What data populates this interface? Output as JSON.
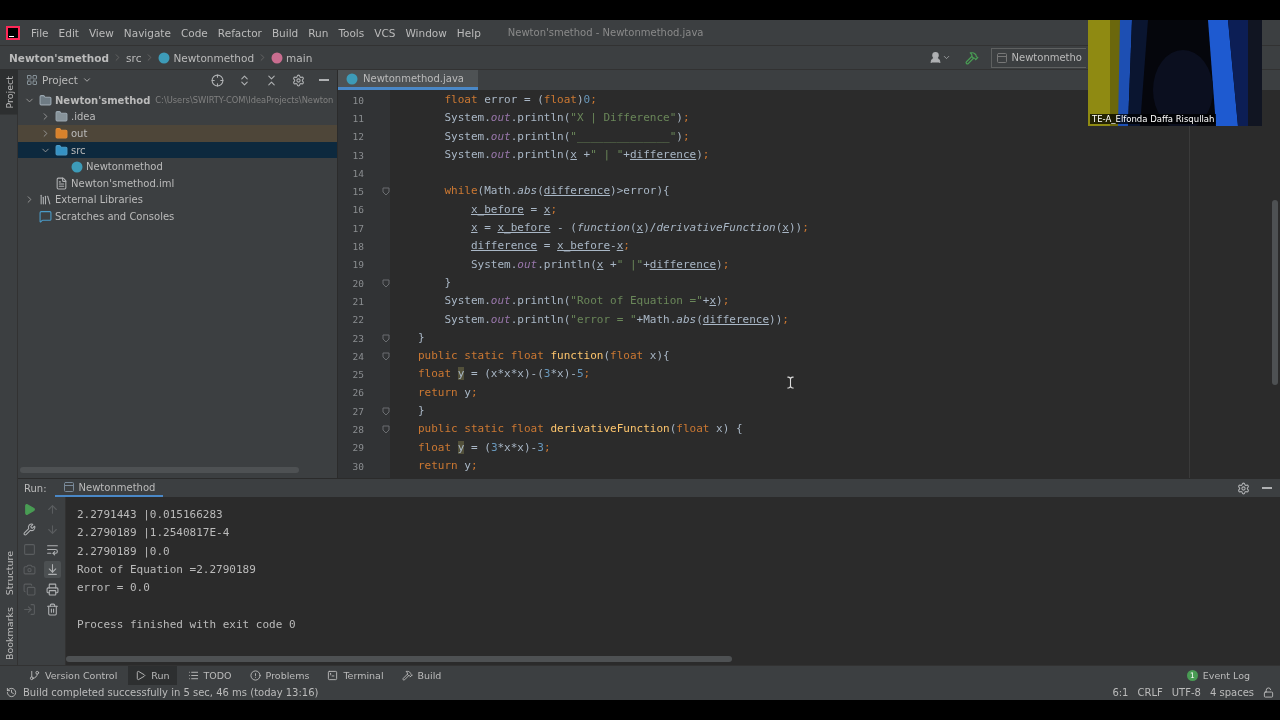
{
  "menu_bar": {
    "items": [
      "File",
      "Edit",
      "View",
      "Navigate",
      "Code",
      "Refactor",
      "Build",
      "Run",
      "Tools",
      "VCS",
      "Window",
      "Help"
    ],
    "title": "Newton'smethod - Newtonmethod.java"
  },
  "breadcrumbs": [
    {
      "label": "Newton'smethod",
      "kind": "project"
    },
    {
      "label": "src",
      "kind": "folder"
    },
    {
      "label": "Newtonmethod",
      "kind": "class"
    },
    {
      "label": "main",
      "kind": "method"
    }
  ],
  "run_config": "Newtonmetho",
  "side_tabs": [
    {
      "label": "Project",
      "selected": true
    },
    {
      "label": "Structure",
      "selected": false
    },
    {
      "label": "Bookmarks",
      "selected": false
    }
  ],
  "project_panel": {
    "title": "Project",
    "tree": [
      {
        "label": "Newton'smethod",
        "hint": "C:\\Users\\SWIRTY-COM\\IdeaProjects\\Newton",
        "kind": "module",
        "expanded": true,
        "selected": false,
        "children": [
          {
            "label": ".idea",
            "kind": "folder",
            "expanded": false,
            "selected": false
          },
          {
            "label": "out",
            "kind": "excluded",
            "expanded": false,
            "selected": false
          },
          {
            "label": "src",
            "kind": "source",
            "expanded": true,
            "selected": true,
            "children": [
              {
                "label": "Newtonmethod",
                "kind": "class",
                "selected": false
              }
            ]
          },
          {
            "label": "Newton'smethod.iml",
            "kind": "file",
            "selected": false
          }
        ]
      },
      {
        "label": "External Libraries",
        "kind": "libraries",
        "expanded": false,
        "selected": false
      },
      {
        "label": "Scratches and Consoles",
        "kind": "scratches",
        "selected": false
      }
    ]
  },
  "editor": {
    "tabs": [
      {
        "label": "Newtonmethod.java",
        "selected": true
      }
    ],
    "lines": [
      {
        "number": "10",
        "fold": false,
        "kind": "body",
        "tokens": [
          {
            "kind": "k",
            "text": "float"
          },
          {
            "kind": "t",
            "text": " error = ("
          },
          {
            "kind": "k",
            "text": "float"
          },
          {
            "kind": "t",
            "text": ")"
          },
          {
            "kind": "n",
            "text": "0"
          },
          {
            "kind": "k",
            "text": ";"
          }
        ]
      },
      {
        "number": "11",
        "fold": false,
        "kind": "body",
        "tokens": [
          {
            "kind": "t",
            "text": "System."
          },
          {
            "kind": "f",
            "text": "out"
          },
          {
            "kind": "t",
            "text": ".println("
          },
          {
            "kind": "s",
            "text": "\"X | Difference\""
          },
          {
            "kind": "t",
            "text": ")"
          },
          {
            "kind": "k",
            "text": ";"
          }
        ]
      },
      {
        "number": "12",
        "fold": false,
        "kind": "body",
        "tokens": [
          {
            "kind": "t",
            "text": "System."
          },
          {
            "kind": "f",
            "text": "out"
          },
          {
            "kind": "t",
            "text": ".println("
          },
          {
            "kind": "s",
            "text": "\"______________\""
          },
          {
            "kind": "t",
            "text": ")"
          },
          {
            "kind": "k",
            "text": ";"
          }
        ]
      },
      {
        "number": "13",
        "fold": false,
        "kind": "body",
        "tokens": [
          {
            "kind": "t",
            "text": "System."
          },
          {
            "kind": "f",
            "text": "out"
          },
          {
            "kind": "t",
            "text": ".println("
          },
          {
            "kind": "u",
            "text": "x"
          },
          {
            "kind": "t",
            "text": " +"
          },
          {
            "kind": "s",
            "text": "\" | \""
          },
          {
            "kind": "t",
            "text": "+"
          },
          {
            "kind": "u",
            "text": "difference"
          },
          {
            "kind": "t",
            "text": ")"
          },
          {
            "kind": "k",
            "text": ";"
          }
        ]
      },
      {
        "number": "14",
        "fold": false,
        "kind": "body"
      },
      {
        "number": "15",
        "fold": true,
        "kind": "body",
        "tokens": [
          {
            "kind": "k",
            "text": "while"
          },
          {
            "kind": "t",
            "text": "(Math."
          },
          {
            "kind": "i",
            "text": "abs"
          },
          {
            "kind": "t",
            "text": "("
          },
          {
            "kind": "u",
            "text": "difference"
          },
          {
            "kind": "t",
            "text": ")>error){"
          }
        ]
      },
      {
        "number": "16",
        "fold": false,
        "kind": "inner",
        "tokens": [
          {
            "kind": "u",
            "text": "x_before"
          },
          {
            "kind": "t",
            "text": " = "
          },
          {
            "kind": "u",
            "text": "x"
          },
          {
            "kind": "k",
            "text": ";"
          }
        ]
      },
      {
        "number": "17",
        "fold": false,
        "kind": "inner",
        "tokens": [
          {
            "kind": "u",
            "text": "x"
          },
          {
            "kind": "t",
            "text": " = "
          },
          {
            "kind": "u",
            "text": "x_before"
          },
          {
            "kind": "t",
            "text": " - ("
          },
          {
            "kind": "i",
            "text": "function"
          },
          {
            "kind": "t",
            "text": "("
          },
          {
            "kind": "u",
            "text": "x"
          },
          {
            "kind": "t",
            "text": ")/"
          },
          {
            "kind": "i",
            "text": "derivativeFunction"
          },
          {
            "kind": "t",
            "text": "("
          },
          {
            "kind": "u",
            "text": "x"
          },
          {
            "kind": "t",
            "text": "))"
          },
          {
            "kind": "k",
            "text": ";"
          }
        ]
      },
      {
        "number": "18",
        "fold": false,
        "kind": "inner",
        "tokens": [
          {
            "kind": "u",
            "text": "difference"
          },
          {
            "kind": "t",
            "text": " = "
          },
          {
            "kind": "u",
            "text": "x_before"
          },
          {
            "kind": "t",
            "text": "-"
          },
          {
            "kind": "u",
            "text": "x"
          },
          {
            "kind": "k",
            "text": ";"
          }
        ]
      },
      {
        "number": "19",
        "fold": false,
        "kind": "inner",
        "tokens": [
          {
            "kind": "t",
            "text": "System."
          },
          {
            "kind": "f",
            "text": "out"
          },
          {
            "kind": "t",
            "text": ".println("
          },
          {
            "kind": "u",
            "text": "x"
          },
          {
            "kind": "t",
            "text": " +"
          },
          {
            "kind": "s",
            "text": "\" |\""
          },
          {
            "kind": "t",
            "text": "+"
          },
          {
            "kind": "u",
            "text": "difference"
          },
          {
            "kind": "t",
            "text": ")"
          },
          {
            "kind": "k",
            "text": ";"
          }
        ]
      },
      {
        "number": "20",
        "fold": true,
        "kind": "body",
        "tokens": [
          {
            "kind": "t",
            "text": "}"
          }
        ]
      },
      {
        "number": "21",
        "fold": false,
        "kind": "body",
        "tokens": [
          {
            "kind": "t",
            "text": "System."
          },
          {
            "kind": "f",
            "text": "out"
          },
          {
            "kind": "t",
            "text": ".println("
          },
          {
            "kind": "s",
            "text": "\"Root of Equation =\""
          },
          {
            "kind": "t",
            "text": "+"
          },
          {
            "kind": "u",
            "text": "x"
          },
          {
            "kind": "t",
            "text": ")"
          },
          {
            "kind": "k",
            "text": ";"
          }
        ]
      },
      {
        "number": "22",
        "fold": false,
        "kind": "body",
        "tokens": [
          {
            "kind": "t",
            "text": "System."
          },
          {
            "kind": "f",
            "text": "out"
          },
          {
            "kind": "t",
            "text": ".println("
          },
          {
            "kind": "s",
            "text": "\"error = \""
          },
          {
            "kind": "t",
            "text": "+Math."
          },
          {
            "kind": "i",
            "text": "abs"
          },
          {
            "kind": "t",
            "text": "("
          },
          {
            "kind": "u",
            "text": "difference"
          },
          {
            "kind": "t",
            "text": "))"
          },
          {
            "kind": "k",
            "text": ";"
          }
        ]
      },
      {
        "number": "23",
        "fold": true,
        "kind": "top",
        "tokens": [
          {
            "kind": "t",
            "text": "}"
          }
        ]
      },
      {
        "number": "24",
        "fold": true,
        "kind": "top",
        "tokens": [
          {
            "kind": "k",
            "text": "public static float "
          },
          {
            "kind": "m",
            "text": "function"
          },
          {
            "kind": "t",
            "text": "("
          },
          {
            "kind": "k",
            "text": "float"
          },
          {
            "kind": "t",
            "text": " x){"
          }
        ]
      },
      {
        "number": "25",
        "fold": false,
        "kind": "top",
        "tokens": [
          {
            "kind": "k",
            "text": "float "
          },
          {
            "kind": "h",
            "text": "y"
          },
          {
            "kind": "t",
            "text": " = (x*x*x)-("
          },
          {
            "kind": "n",
            "text": "3"
          },
          {
            "kind": "t",
            "text": "*x)-"
          },
          {
            "kind": "n",
            "text": "5"
          },
          {
            "kind": "k",
            "text": ";"
          }
        ]
      },
      {
        "number": "26",
        "fold": false,
        "kind": "top",
        "tokens": [
          {
            "kind": "k",
            "text": "return"
          },
          {
            "kind": "t",
            "text": " y"
          },
          {
            "kind": "k",
            "text": ";"
          }
        ]
      },
      {
        "number": "27",
        "fold": true,
        "kind": "top",
        "tokens": [
          {
            "kind": "t",
            "text": "}"
          }
        ]
      },
      {
        "number": "28",
        "fold": true,
        "kind": "top",
        "tokens": [
          {
            "kind": "k",
            "text": "public static float "
          },
          {
            "kind": "m",
            "text": "derivativeFunction"
          },
          {
            "kind": "t",
            "text": "("
          },
          {
            "kind": "k",
            "text": "float"
          },
          {
            "kind": "t",
            "text": " x) {"
          }
        ]
      },
      {
        "number": "29",
        "fold": false,
        "kind": "top",
        "tokens": [
          {
            "kind": "k",
            "text": "float "
          },
          {
            "kind": "h",
            "text": "y"
          },
          {
            "kind": "t",
            "text": " = ("
          },
          {
            "kind": "n",
            "text": "3"
          },
          {
            "kind": "t",
            "text": "*x*x)-"
          },
          {
            "kind": "n",
            "text": "3"
          },
          {
            "kind": "k",
            "text": ";"
          }
        ]
      },
      {
        "number": "30",
        "fold": false,
        "kind": "top",
        "tokens": [
          {
            "kind": "k",
            "text": "return"
          },
          {
            "kind": "t",
            "text": " y"
          },
          {
            "kind": "k",
            "text": ";"
          }
        ]
      }
    ]
  },
  "run_panel": {
    "label": "Run:",
    "tab": "Newtonmethod",
    "toolbar_left": [
      {
        "kind": "rerun",
        "disabled": false
      },
      {
        "kind": "settings",
        "disabled": false
      },
      {
        "kind": "stop",
        "disabled": true
      },
      {
        "kind": "dump",
        "disabled": true
      },
      {
        "kind": "restore",
        "disabled": true
      },
      {
        "kind": "exit",
        "disabled": true
      }
    ],
    "toolbar_right": [
      {
        "kind": "up",
        "disabled": true,
        "selected": false
      },
      {
        "kind": "down",
        "disabled": true,
        "selected": false
      },
      {
        "kind": "wrap",
        "disabled": false,
        "selected": false
      },
      {
        "kind": "scroll",
        "disabled": false,
        "selected": true
      },
      {
        "kind": "print",
        "disabled": false,
        "selected": false
      },
      {
        "kind": "clear",
        "disabled": false,
        "selected": false
      }
    ],
    "output": [
      "2.2791443 |0.015166283",
      "2.2790189 |1.2540817E-4",
      "2.2790189 |0.0",
      "Root of Equation =2.2790189",
      "error = 0.0"
    ],
    "exit_message": "Process finished with exit code 0"
  },
  "tool_windows": [
    {
      "label": "Version Control",
      "kind": "vcs",
      "selected": false
    },
    {
      "label": "Run",
      "kind": "run",
      "selected": true
    },
    {
      "label": "TODO",
      "kind": "todo",
      "selected": false
    },
    {
      "label": "Problems",
      "kind": "problems",
      "selected": false
    },
    {
      "label": "Terminal",
      "kind": "terminal",
      "selected": false
    },
    {
      "label": "Build",
      "kind": "build",
      "selected": false
    }
  ],
  "event_log": {
    "label": "Event Log",
    "badge": "1"
  },
  "status_bar": {
    "message": "Build completed successfully in 5 sec, 46 ms (today 13:16)",
    "items": [
      "6:1",
      "CRLF",
      "UTF-8",
      "4 spaces"
    ]
  },
  "video_overlay": {
    "kind": "picture",
    "name": "TE-A_Elfonda Daffa Risqullah"
  }
}
